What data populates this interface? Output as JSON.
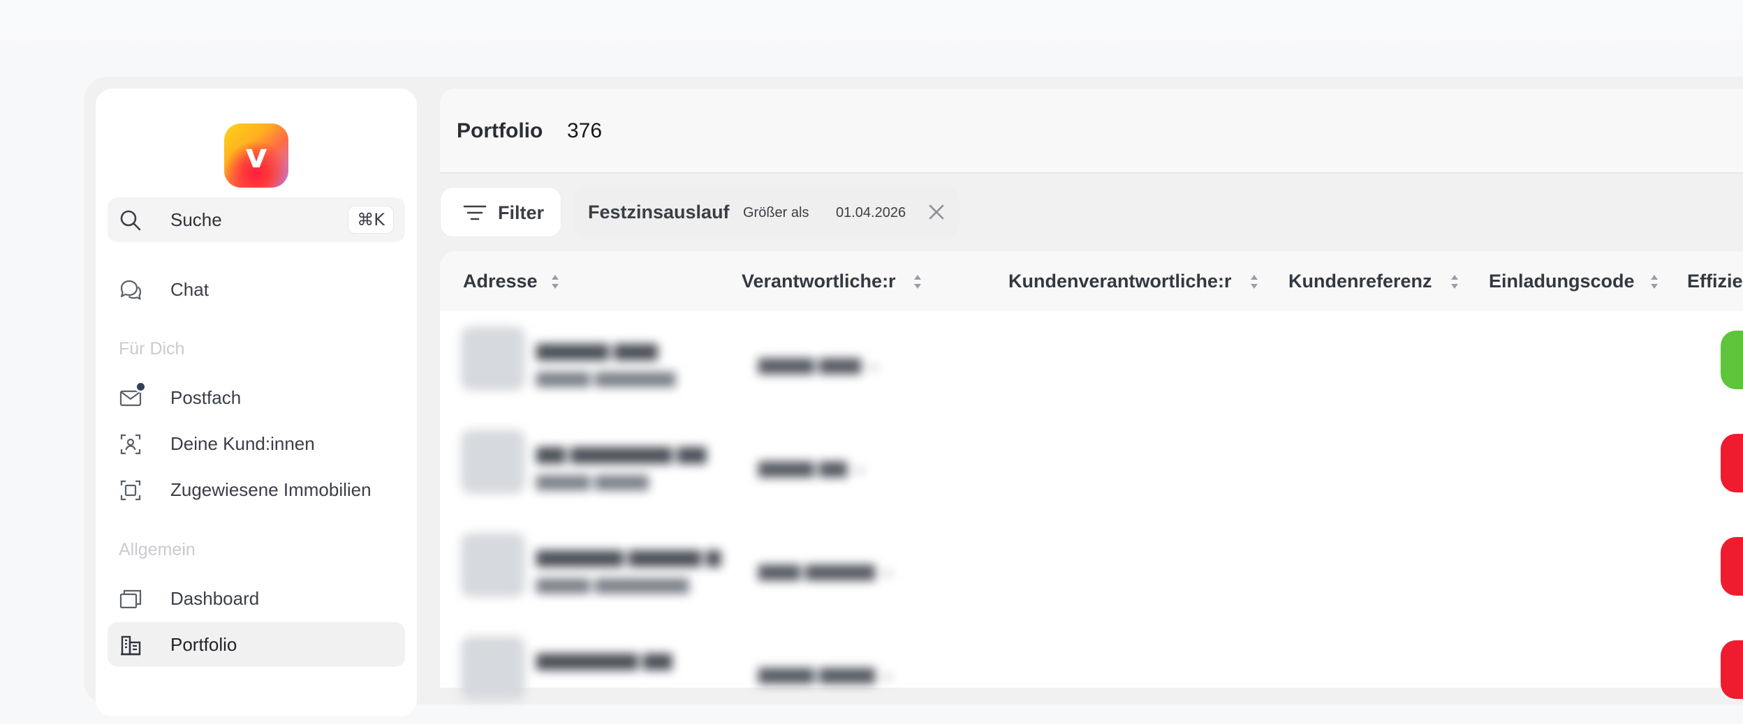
{
  "logo": {
    "letter": "v"
  },
  "sidebar": {
    "search": {
      "label": "Suche",
      "shortcut": "⌘K"
    },
    "chat": {
      "label": "Chat"
    },
    "sections": [
      {
        "title": "Für Dich"
      },
      {
        "title": "Allgemein"
      }
    ],
    "fuer_dich": [
      {
        "label": "Postfach",
        "icon": "mail-icon",
        "has_notification": true
      },
      {
        "label": "Deine Kund:innen",
        "icon": "person-scan-icon"
      },
      {
        "label": "Zugewiesene Immobilien",
        "icon": "focus-frame-icon"
      }
    ],
    "allgemein": [
      {
        "label": "Dashboard",
        "icon": "windows-icon"
      },
      {
        "label": "Portfolio",
        "icon": "buildings-icon",
        "active": true
      }
    ]
  },
  "header": {
    "title": "Portfolio",
    "count": "376"
  },
  "filters": {
    "button_label": "Filter",
    "chip": {
      "field": "Festzinsauslauf",
      "operator": "Größer als",
      "value": "01.04.2026"
    }
  },
  "table": {
    "columns": [
      {
        "label": "Adresse"
      },
      {
        "label": "Verantwortliche:r"
      },
      {
        "label": "Kundenverantwortliche:r"
      },
      {
        "label": "Kundenreferenz"
      },
      {
        "label": "Einladungscode"
      },
      {
        "label": "Effizie"
      }
    ],
    "rows": [
      {
        "efficiency_color": "#5ec43a"
      },
      {
        "efficiency_color": "#ee1c2e"
      },
      {
        "efficiency_color": "#ee1c2e"
      },
      {
        "efficiency_color": "#ee1c2e"
      }
    ]
  },
  "colors": {
    "accent_dot": "#334155",
    "active_bg": "#f1f1f1"
  }
}
